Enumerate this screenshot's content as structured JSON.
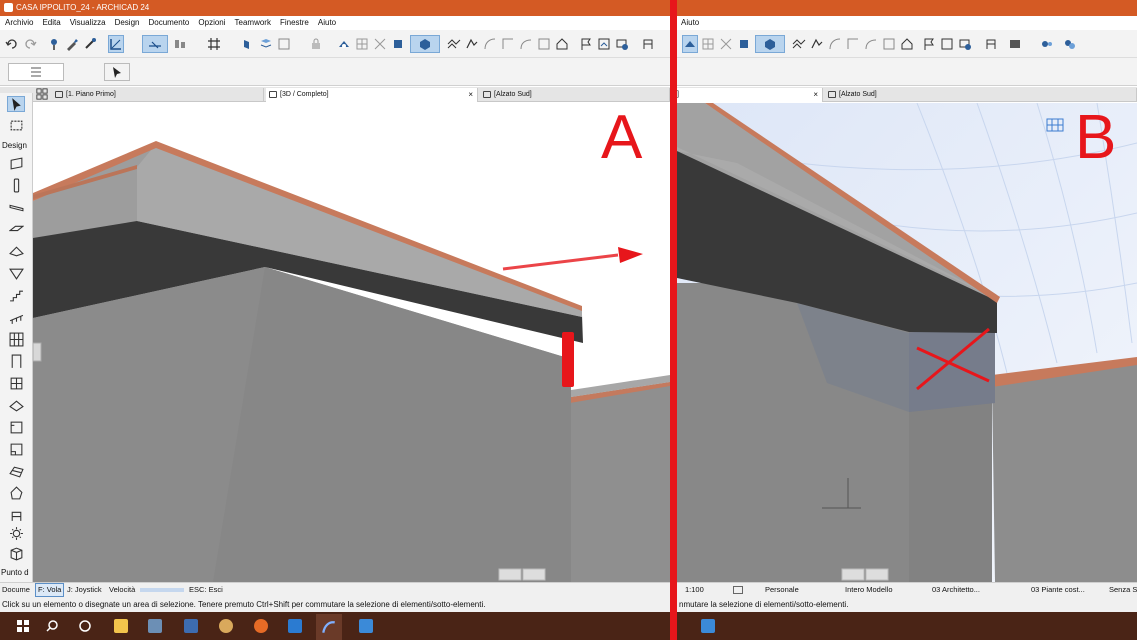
{
  "window": {
    "title": "CASA IPPOLITO_24 - ARCHICAD 24"
  },
  "menu": [
    "Archivio",
    "Edita",
    "Visualizza",
    "Design",
    "Documento",
    "Opzioni",
    "Teamwork",
    "Finestre",
    "Aiuto"
  ],
  "menu_b": [
    "Aiuto"
  ],
  "tabs_a": [
    {
      "label": "[1. Piano Primo]"
    },
    {
      "label": "[3D / Completo]",
      "close": "×"
    },
    {
      "label": "[Alzato Sud]"
    }
  ],
  "tabs_b": [
    {
      "label": "]",
      "close": "×"
    },
    {
      "label": "[Alzato Sud]"
    }
  ],
  "left_palette": {
    "section_label": "Design",
    "bottom_label": "Punto d"
  },
  "statusbar_a": {
    "doc": "Docume",
    "fly": "F: Vola",
    "joystick": "J: Joystick",
    "speed": "Velocità",
    "esc": "ESC: Esci"
  },
  "statusbar_b": {
    "scale": "1:100",
    "pen": "Personale",
    "model": "Intero Modello",
    "layer": "03 Architetto...",
    "plan": "03 Piante cost...",
    "misc": "Senza S"
  },
  "hint_a": "Click su un elemento o disegnate un area di selezione. Tenere premuto Ctrl+Shift per commutare la selezione di elementi/sotto-elementi.",
  "hint_b": "nmutare la selezione di elementi/sotto-elementi.",
  "annotations": {
    "label_a": "A",
    "label_b": "B",
    "accent": "#e7161b"
  },
  "colors": {
    "title_bar": "#d45a24",
    "taskbar": "#4a2416",
    "roof_edge": "#c77a5c",
    "wall": "#8c8c8c"
  },
  "icons": {
    "toolbar": [
      "undo-icon",
      "redo-icon",
      "pick-up-icon",
      "eyedropper-icon",
      "inject-icon",
      "snap-guide-icon",
      "guideline-icon",
      "align-icon",
      "grid-icon",
      "lock-icon",
      "3d-navigation-icon",
      "explode-icon",
      "selection-icon",
      "trim-icon",
      "section-icon",
      "elevation-icon",
      "marker-icon",
      "flag-icon",
      "render-icon"
    ],
    "left_palette": [
      "arrow-tool-icon",
      "marquee-tool-icon",
      "wall-tool-icon",
      "column-tool-icon",
      "beam-tool-icon",
      "slab-tool-icon",
      "roof-tool-icon",
      "shell-tool-icon",
      "stair-tool-icon",
      "railing-tool-icon",
      "curtain-wall-tool-icon",
      "door-tool-icon",
      "window-tool-icon",
      "skylight-tool-icon",
      "mesh-tool-icon",
      "zone-tool-icon",
      "morph-tool-icon",
      "object-tool-icon",
      "lamp-tool-icon",
      "box-tool-icon"
    ],
    "taskbar": [
      "windows-start-icon",
      "search-icon",
      "cortana-icon",
      "file-explorer-icon",
      "notepad-icon",
      "calculator-icon",
      "paint-icon",
      "firefox-icon",
      "remote-icon",
      "archicad-icon",
      "bimx-icon"
    ]
  }
}
